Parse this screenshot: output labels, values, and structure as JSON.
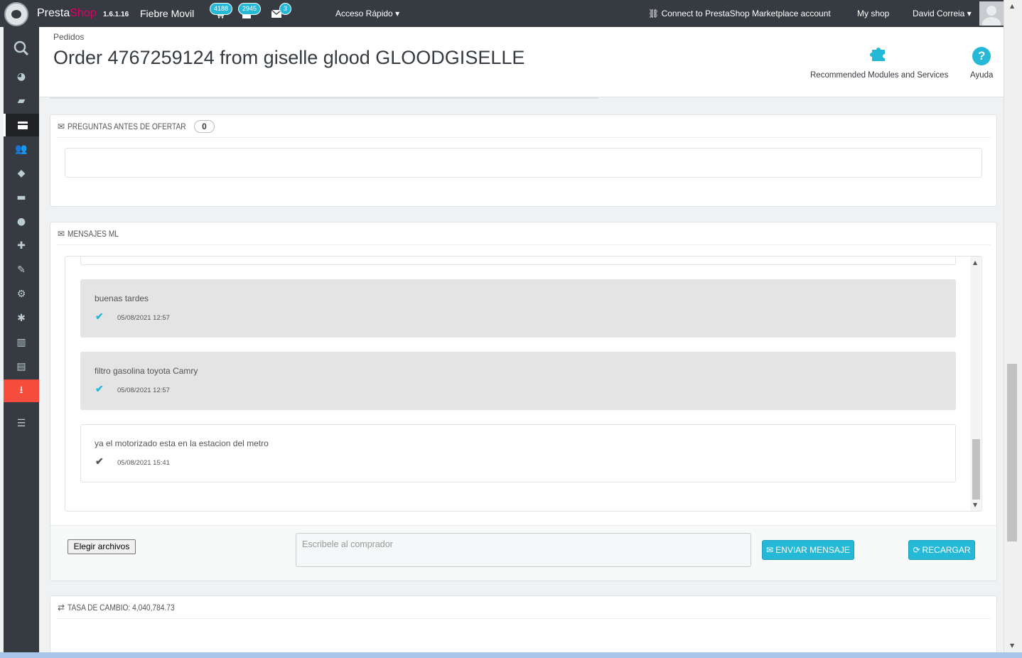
{
  "header": {
    "brand_presta": "Presta",
    "brand_shop": "Shop",
    "version": "1.6.1.16",
    "store_name": "Fiebre Movil",
    "notifications": [
      {
        "icon": "cart-icon",
        "count": "4188"
      },
      {
        "icon": "user-icon",
        "count": "2945"
      },
      {
        "icon": "envelope-icon",
        "count": "3"
      }
    ],
    "quick_access": "Acceso Rápido",
    "marketplace": "Connect to PrestaShop Marketplace account",
    "my_shop": "My shop",
    "user_name": "David Correia"
  },
  "sidebar": {
    "items": [
      "search-icon",
      "dashboard-icon",
      "catalog-icon",
      "orders-icon",
      "customers-icon",
      "price-rules-icon",
      "shipping-icon",
      "localization-icon",
      "modules-icon",
      "preferences-icon",
      "advanced-parameters-icon",
      "administration-icon",
      "stats-icon",
      "archive-icon",
      "download-icon",
      "menu-collapse-icon"
    ]
  },
  "page": {
    "breadcrumb": "Pedidos",
    "title": "Order 4767259124 from giselle glood GLOODGISELLE",
    "toolbar": {
      "recommended": "Recommended Modules and Services",
      "help": "Ayuda"
    }
  },
  "questions_panel": {
    "title": "PREGUNTAS ANTES DE OFERTAR",
    "count": "0"
  },
  "messages_panel": {
    "title": "MENSAJES ML",
    "messages": [
      {
        "text": "buenas tardes",
        "time": "05/08/2021 12:57"
      },
      {
        "text": "filtro gasolina toyota Camry",
        "time": "05/08/2021 12:57"
      },
      {
        "text": "ya el motorizado esta en la estacion del metro",
        "time": "05/08/2021 15:41"
      }
    ],
    "file_button": "Elegir archivos",
    "compose_placeholder": "Escribele al comprador",
    "send_button": "ENVIAR MENSAJE",
    "reload_button": "RECARGAR"
  },
  "exchange_panel": {
    "title": "TASA DE CAMBIO: 4,040,784.73"
  },
  "colors": {
    "accent": "#25b9d7",
    "sidebar": "#363a41",
    "active_menu": "#f54c3e",
    "brand_pink": "#df0067"
  }
}
